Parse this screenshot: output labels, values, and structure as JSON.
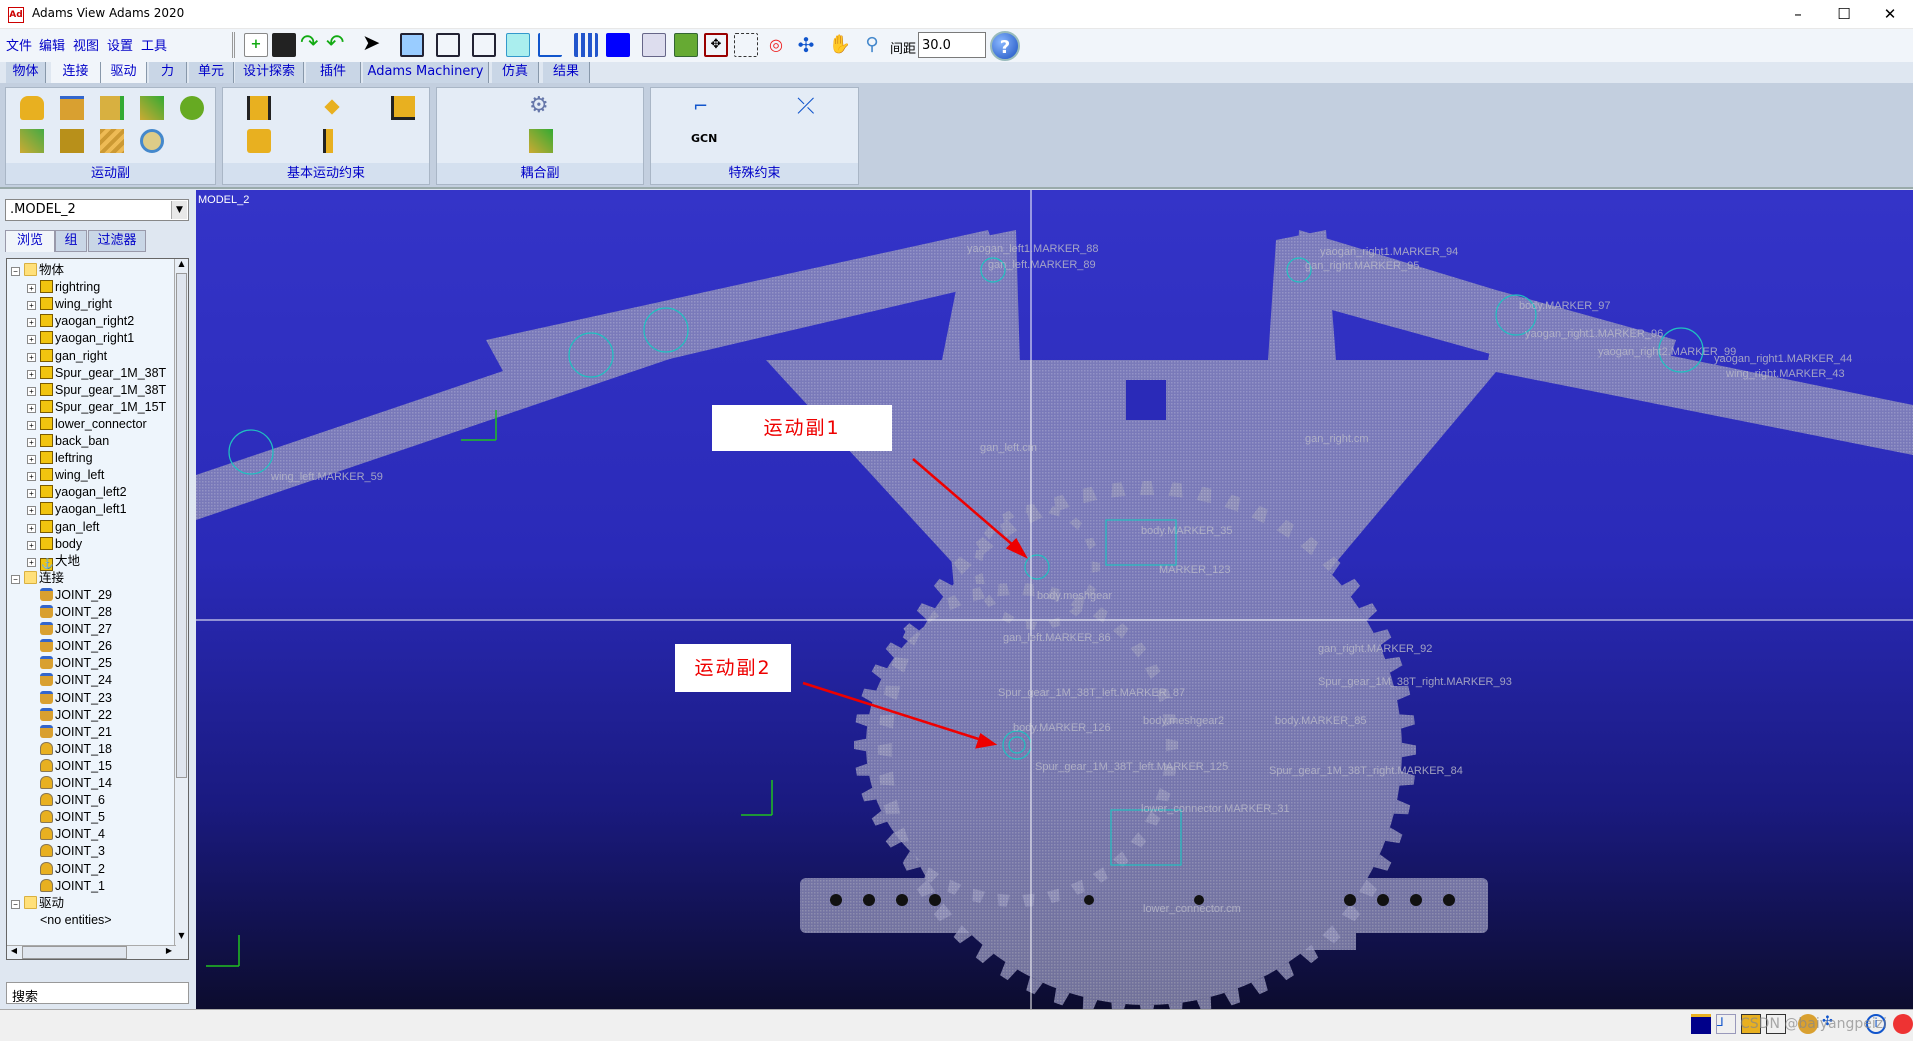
{
  "window": {
    "title": "Adams View Adams 2020",
    "app_icon": "Ad",
    "controls": {
      "minimize": "–",
      "maximize": "☐",
      "close": "✕"
    }
  },
  "menu": [
    "文件",
    "编辑",
    "视图",
    "设置",
    "工具"
  ],
  "toolbar": {
    "spacing_label": "间距",
    "spacing_value": "30.0",
    "help": "?"
  },
  "tabs": [
    "物体",
    "连接",
    "驱动",
    "力",
    "单元",
    "设计探索",
    "插件",
    "Adams Machinery",
    "仿真",
    "结果"
  ],
  "active_tab": "连接",
  "ribbon": {
    "groups": [
      {
        "label": "运动副"
      },
      {
        "label": "基本运动约束"
      },
      {
        "label": "耦合副"
      },
      {
        "label": "特殊约束",
        "gcn": "GCN"
      }
    ]
  },
  "panel": {
    "model": ".MODEL_2",
    "tabs": [
      "浏览",
      "组",
      "过滤器"
    ],
    "search": "搜索"
  },
  "tree": {
    "bodies_label": "物体",
    "bodies": [
      "rightring",
      "wing_right",
      "yaogan_right2",
      "yaogan_right1",
      "gan_right",
      "Spur_gear_1M_38T",
      "Spur_gear_1M_38T",
      "Spur_gear_1M_15T",
      "lower_connector",
      "back_ban",
      "leftring",
      "wing_left",
      "yaogan_left2",
      "yaogan_left1",
      "gan_left",
      "body",
      "大地"
    ],
    "joints_label": "连接",
    "joints": [
      "JOINT_29",
      "JOINT_28",
      "JOINT_27",
      "JOINT_26",
      "JOINT_25",
      "JOINT_24",
      "JOINT_23",
      "JOINT_22",
      "JOINT_21",
      "JOINT_18",
      "JOINT_15",
      "JOINT_14",
      "JOINT_6",
      "JOINT_5",
      "JOINT_4",
      "JOINT_3",
      "JOINT_2",
      "JOINT_1"
    ],
    "motions_label": "驱动",
    "motions_empty": "<no entities>"
  },
  "viewport": {
    "model_name": "MODEL_2",
    "callouts": [
      "运动副1",
      "运动副2"
    ],
    "labels": [
      "yaogan_left1.MARKER_88",
      "gan_left.MARKER_89",
      "yaogan_right1.MARKER_94",
      "gan_right.MARKER_95",
      "body.MARKER_97",
      "yaogan_right1.MARKER_96",
      "yaogan_right2.MARKER_99",
      "yaogan_right1.MARKER_44",
      "wing_right.MARKER_43",
      "wing_left.MARKER_59",
      "gan_left.cm",
      "gan_right.cm",
      "body.MARKER_35",
      "MARKER_123",
      "body.meshgear",
      "gan_left.MARKER_86",
      "gan_right.MARKER_92",
      "Spur_gear_1M_38T_right.MARKER_93",
      "Spur_gear_1M_38T_left.MARKER_87",
      "body.meshgear2",
      "body.MARKER_85",
      "body.MARKER_126",
      "Spur_gear_1M_38T_right.MARKER_84",
      "Spur_gear_1M_38T_left.MARKER_125",
      "lower_connector.MARKER_31",
      "lower_connector.cm"
    ],
    "colors": {
      "background_top": "#3434c8",
      "background_bottom": "#0c0c2e",
      "geometry": "#9a9ab8",
      "marker": "#20c0c0",
      "callout_text": "#ee0000",
      "arrow": "#ee0000"
    }
  },
  "status": {
    "watermark": "CSDN @baiyangpeizi"
  }
}
